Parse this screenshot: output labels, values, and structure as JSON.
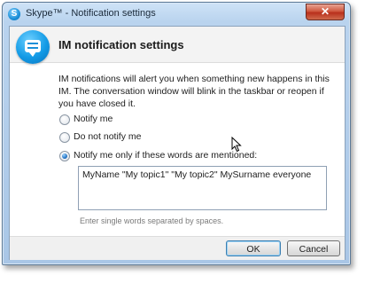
{
  "window": {
    "title": "Skype™ - Notification settings",
    "close_glyph": "✕",
    "app_icon": "skype-icon",
    "app_icon_letter": "S"
  },
  "header": {
    "title": "IM notification settings",
    "icon": "chat-bubble-icon"
  },
  "description": "IM notifications will alert you when something new happens in this IM. The conversation window will blink in the taskbar or reopen if you have closed it.",
  "options": [
    {
      "label": "Notify me",
      "checked": false
    },
    {
      "label": "Do not notify me",
      "checked": false
    },
    {
      "label": "Notify me only if these words are mentioned:",
      "checked": true
    }
  ],
  "keywords": {
    "value": "MyName \"My topic1\" \"My topic2\" MySurname everyone"
  },
  "hint": "Enter single words separated by spaces.",
  "buttons": {
    "ok": "OK",
    "cancel": "Cancel"
  },
  "colors": {
    "accent": "#1a8fd8",
    "close_button": "#c8432b"
  }
}
